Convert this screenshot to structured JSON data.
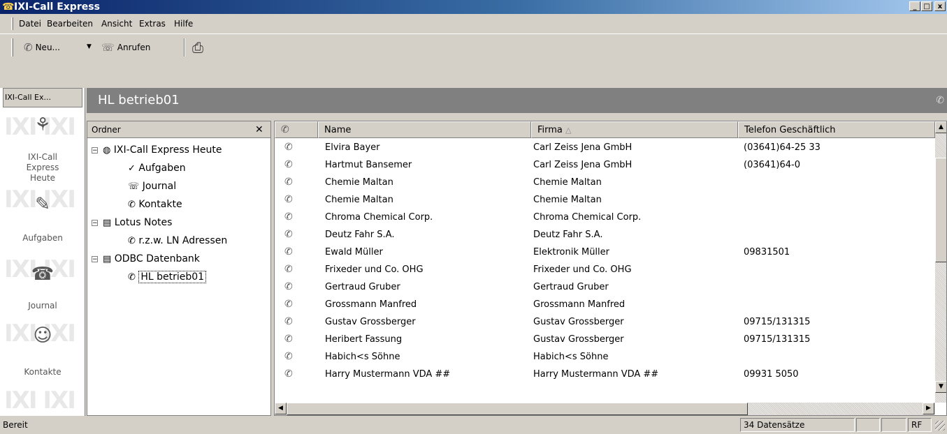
{
  "window": {
    "title": "IXI-Call Express",
    "minimize": "_",
    "maximize": "□",
    "close": "x"
  },
  "menu": [
    "Datei",
    "Bearbeiten",
    "Ansicht",
    "Extras",
    "Hilfe"
  ],
  "toolbar": {
    "new_label": "Neu...",
    "call_label": "Anrufen"
  },
  "leftbar": {
    "button": "IXI-Call Ex...",
    "items": [
      {
        "label": "IXI-Call Express Heute",
        "lines": [
          "IXI-Call",
          "Express",
          "Heute"
        ],
        "icon": "today-icon"
      },
      {
        "label": "Aufgaben",
        "icon": "tasks-icon"
      },
      {
        "label": "Journal",
        "icon": "journal-icon"
      },
      {
        "label": "Kontakte",
        "icon": "contacts-icon"
      }
    ]
  },
  "header": {
    "title": "HL betrieb01"
  },
  "folders": {
    "title": "Ordner",
    "close": "✕",
    "tree": [
      {
        "label": "IXI-Call Express Heute",
        "level": 0,
        "expanded": true
      },
      {
        "label": "Aufgaben",
        "level": 1
      },
      {
        "label": "Journal",
        "level": 1
      },
      {
        "label": "Kontakte",
        "level": 1
      },
      {
        "label": "Lotus Notes",
        "level": 0,
        "expanded": true
      },
      {
        "label": "r.z.w. LN Adressen",
        "level": 1
      },
      {
        "label": "ODBC Datenbank",
        "level": 0,
        "expanded": true
      },
      {
        "label": "HL betrieb01",
        "level": 1,
        "selected": true
      }
    ]
  },
  "table": {
    "columns": [
      "Name",
      "Firma",
      "Telefon Geschäftlich"
    ],
    "sort_indicator": "△",
    "rows": [
      [
        "Elvira Bayer",
        "Carl Zeiss Jena GmbH",
        "(03641)64-25 33"
      ],
      [
        "Hartmut Bansemer",
        "Carl Zeiss Jena GmbH",
        "(03641)64-0"
      ],
      [
        "Chemie Maltan",
        "Chemie Maltan",
        ""
      ],
      [
        "Chemie Maltan",
        "Chemie Maltan",
        ""
      ],
      [
        "Chroma Chemical Corp.",
        "Chroma Chemical Corp.",
        ""
      ],
      [
        "Deutz Fahr S.A.",
        "Deutz Fahr S.A.",
        ""
      ],
      [
        "Ewald Müller",
        "Elektronik Müller",
        "09831501"
      ],
      [
        "Frixeder und Co. OHG",
        "Frixeder und Co. OHG",
        ""
      ],
      [
        "Gertraud Gruber",
        "Gertraud Gruber",
        ""
      ],
      [
        "Grossmann Manfred",
        "Grossmann Manfred",
        ""
      ],
      [
        "Gustav  Grossberger",
        "Gustav  Grossberger",
        "09715/131315"
      ],
      [
        "Heribert Fassung",
        "Gustav  Grossberger",
        "09715/131315"
      ],
      [
        "Habich<s Söhne",
        "Habich<s Söhne",
        ""
      ],
      [
        "Harry Mustermann VDA     ##",
        "Harry Mustermann VDA     ##",
        "09931 5050"
      ]
    ]
  },
  "status": {
    "text": "Bereit",
    "count": "34 Datensätze",
    "mode": "RF"
  }
}
